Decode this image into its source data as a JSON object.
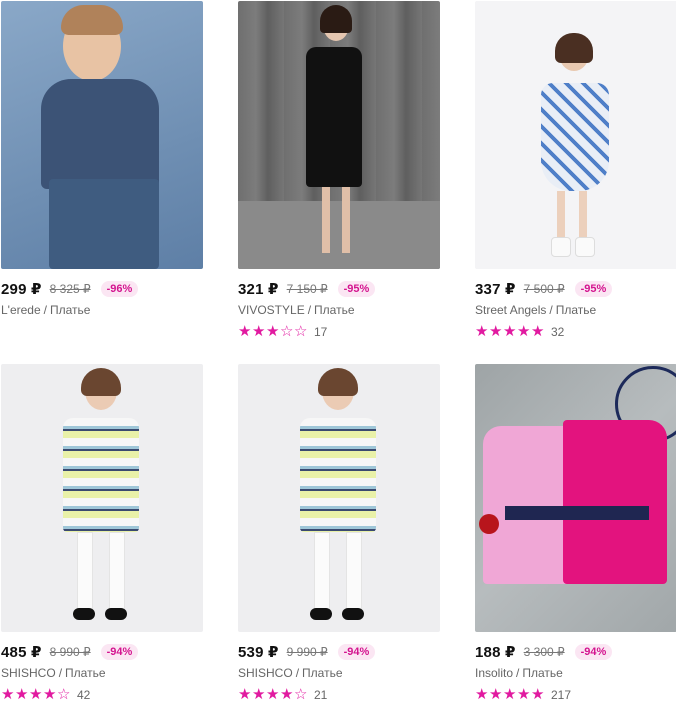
{
  "products": [
    {
      "price": "299 ₽",
      "old_price": "8 325 ₽",
      "discount": "-96%",
      "brand": "L'erede",
      "category": "Платье",
      "rating": 0,
      "reviews": ""
    },
    {
      "price": "321 ₽",
      "old_price": "7 150 ₽",
      "discount": "-95%",
      "brand": "VIVOSTYLE",
      "category": "Платье",
      "rating": 3,
      "reviews": "17"
    },
    {
      "price": "337 ₽",
      "old_price": "7 500 ₽",
      "discount": "-95%",
      "brand": "Street Angels",
      "category": "Платье",
      "rating": 5,
      "reviews": "32"
    },
    {
      "price": "485 ₽",
      "old_price": "8 990 ₽",
      "discount": "-94%",
      "brand": "SHISHCO",
      "category": "Платье",
      "rating": 4,
      "reviews": "42"
    },
    {
      "price": "539 ₽",
      "old_price": "9 990 ₽",
      "discount": "-94%",
      "brand": "SHISHCO",
      "category": "Платье",
      "rating": 4,
      "reviews": "21"
    },
    {
      "price": "188 ₽",
      "old_price": "3 300 ₽",
      "discount": "-94%",
      "brand": "Insolito",
      "category": "Платье",
      "rating": 5,
      "reviews": "217"
    }
  ],
  "separator": "/",
  "colors": {
    "accent": "#e11aa0",
    "discount_bg": "#fbe6f3"
  }
}
